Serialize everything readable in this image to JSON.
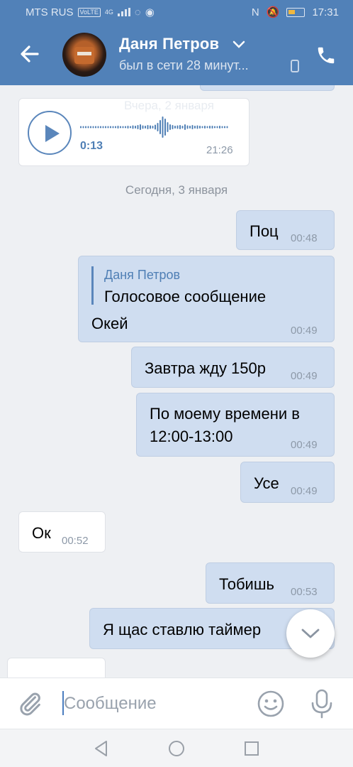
{
  "status_bar": {
    "carrier": "MTS RUS",
    "volte": "VoLTE",
    "network": "4G",
    "time": "17:31"
  },
  "header": {
    "contact_name": "Даня Петров",
    "last_seen": "был в сети 28 минут..."
  },
  "messages": {
    "faded_date": "Вчера, 2 января",
    "voice": {
      "duration": "0:13",
      "time": "21:26"
    },
    "date_separator": "Сегодня, 3 января",
    "m1": {
      "text": "Поц",
      "time": "00:48"
    },
    "m2": {
      "reply_author": "Даня Петров",
      "reply_text": "Голосовое сообщение",
      "text": "Окей",
      "time": "00:49"
    },
    "m3": {
      "text": "Завтра жду 150р",
      "time": "00:49"
    },
    "m4": {
      "line1": "По моему времени в",
      "line2": "12:00-13:00",
      "time": "00:49"
    },
    "m5": {
      "text": "Усе",
      "time": "00:49"
    },
    "m6": {
      "text": "Ок",
      "time": "00:52"
    },
    "m7": {
      "text": "Тобишь",
      "time": "00:53"
    },
    "m8": {
      "text": "Я щас ставлю таймер"
    }
  },
  "composer": {
    "placeholder": "Сообщение"
  },
  "colors": {
    "header": "#5181b8",
    "outgoing": "#cfddf0",
    "incoming": "#ffffff",
    "accent": "#5a86bb",
    "background": "#eef0f3"
  },
  "icons": [
    "back-arrow-icon",
    "chevron-down-icon",
    "mobile-icon",
    "phone-icon",
    "play-icon",
    "waveform-icon",
    "paperclip-icon",
    "smile-icon",
    "mic-icon",
    "nav-back-icon",
    "nav-home-icon",
    "nav-recents-icon"
  ]
}
